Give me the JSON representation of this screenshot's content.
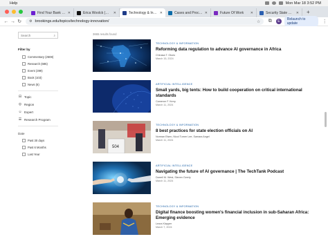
{
  "menubar": {
    "app_menu": "Help",
    "clock": "Mon Mar 18  3:52 PM"
  },
  "tabs": [
    {
      "title": "Find Your Bank | Zell",
      "color": "#6c1fd1"
    },
    {
      "title": "Erica Woolck (@ETE)",
      "color": "#111111"
    },
    {
      "title": "Technology & Innov...",
      "color": "#1f3c88"
    },
    {
      "title": "Cases and Proceedin...",
      "color": "#0b6ba8"
    },
    {
      "title": "Future Of Work",
      "color": "#7a2ac0"
    },
    {
      "title": "Security State Bank",
      "color": "#2b5fb0"
    }
  ],
  "address": {
    "url": "brookings.edu/topics/technology-innovation/",
    "avatar_letter": "E",
    "relaunch": "Relaunch to update"
  },
  "sidebar": {
    "search_placeholder": "Search",
    "filter_title": "Filter by",
    "content_types": [
      "Commentary (2508)",
      "Research (685)",
      "Event (399)",
      "Book (103)",
      "News (6)"
    ],
    "facets": [
      {
        "label": "Topic",
        "icon": "tag-icon",
        "glyph": "⊟"
      },
      {
        "label": "Region",
        "icon": "globe-icon",
        "glyph": "◎"
      },
      {
        "label": "Expert",
        "icon": "person-icon",
        "glyph": "☺"
      },
      {
        "label": "Research Program",
        "icon": "list-icon",
        "glyph": "☰"
      }
    ],
    "date_title": "Date",
    "dates": [
      "Past 30 days",
      "Past 6 Months",
      "Last Year"
    ]
  },
  "results": {
    "count": "3665 results found",
    "items": [
      {
        "category": "TECHNOLOGY & INFORMATION",
        "title": "Reforming data regulation to advance AI governance in Africa",
        "authors": "Chinasa T. Okolo",
        "date": "March 15, 2024"
      },
      {
        "category": "ARTIFICIAL INTELLIGENCE",
        "title": "Small yards, big tents: How to build cooperation on critical international standards",
        "authors": "Cameron F. Kerry",
        "date": "March 11, 2024"
      },
      {
        "category": "TECHNOLOGY & INFORMATION",
        "title": "8 best practices for state election officials on AI",
        "authors": "Norman Eisen, Nicol Turner Lee, Samara Angel",
        "date": "March 11, 2024",
        "image_caption": "504"
      },
      {
        "category": "ARTIFICIAL INTELLIGENCE",
        "title": "Navigating the future of AI governance | The TechTank Podcast",
        "authors": "Darrell M. West, Steven Overly",
        "date": "March 11, 2024"
      },
      {
        "category": "TECHNOLOGY & INFORMATION",
        "title": "Digital finance boosting women's financial inclusion in sub-Saharan Africa: Emerging evidence",
        "authors": "Leora Klapper",
        "date": "March 7, 2024"
      }
    ]
  },
  "colors": {
    "accent_blue": "#1f63a8",
    "traffic_red": "#ff5f57",
    "traffic_yellow": "#febc2e",
    "traffic_green": "#28c840"
  }
}
